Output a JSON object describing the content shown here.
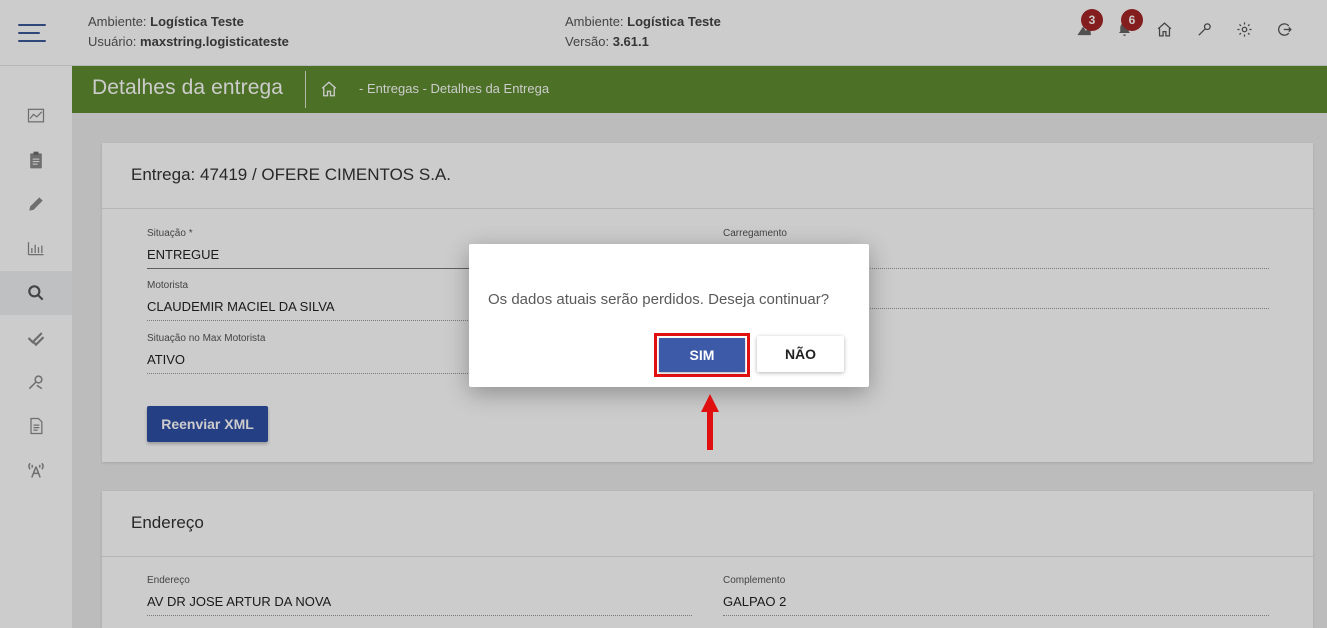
{
  "colors": {
    "green_header": "#5e8d30",
    "primary_button": "#2d4fa6",
    "badge": "#a52525",
    "highlight": "#e01010"
  },
  "header": {
    "env_left": {
      "ambiente_label": "Ambiente:",
      "ambiente_value": "Logística Teste",
      "usuario_label": "Usuário:",
      "usuario_value": "maxstring.logisticateste"
    },
    "env_mid": {
      "ambiente_label": "Ambiente:",
      "ambiente_value": "Logística Teste",
      "versao_label": "Versão:",
      "versao_value": "3.61.1"
    },
    "icons": [
      {
        "name": "truck-notification-icon",
        "badge": "3"
      },
      {
        "name": "bell-icon",
        "badge": "6"
      },
      {
        "name": "home-icon"
      },
      {
        "name": "wrench-icon"
      },
      {
        "name": "gear-icon"
      },
      {
        "name": "logout-icon"
      }
    ]
  },
  "sidebar": {
    "items": [
      {
        "icon": "dashboard-chart-icon"
      },
      {
        "icon": "clipboard-icon"
      },
      {
        "icon": "pencil-icon"
      },
      {
        "icon": "bar-chart-icon"
      },
      {
        "icon": "search-icon",
        "active": true
      },
      {
        "icon": "double-check-icon"
      },
      {
        "icon": "tools-icon"
      },
      {
        "icon": "document-icon"
      },
      {
        "icon": "antenna-icon"
      }
    ]
  },
  "page": {
    "title": "Detalhes da entrega",
    "breadcrumb": "- Entregas - Detalhes da Entrega"
  },
  "delivery_card": {
    "title": "Entrega: 47419 / OFERE CIMENTOS S.A.",
    "fields": {
      "situacao": {
        "label": "Situação *",
        "value": "ENTREGUE"
      },
      "carregamento": {
        "label": "Carregamento",
        "value": ""
      },
      "motorista": {
        "label": "Motorista",
        "value": "CLAUDEMIR MACIEL DA SILVA"
      },
      "situacao_max": {
        "label": "Situação no Max Motorista",
        "value": "ATIVO"
      }
    },
    "resend_button": "Reenviar XML"
  },
  "address_card": {
    "title": "Endereço",
    "fields": {
      "endereco": {
        "label": "Endereço",
        "value": "AV DR JOSE ARTUR DA NOVA"
      },
      "complemento": {
        "label": "Complemento",
        "value": "GALPAO 2"
      }
    }
  },
  "dialog": {
    "message": "Os dados atuais serão perdidos. Deseja continuar?",
    "confirm_label": "SIM",
    "cancel_label": "NÃO"
  }
}
